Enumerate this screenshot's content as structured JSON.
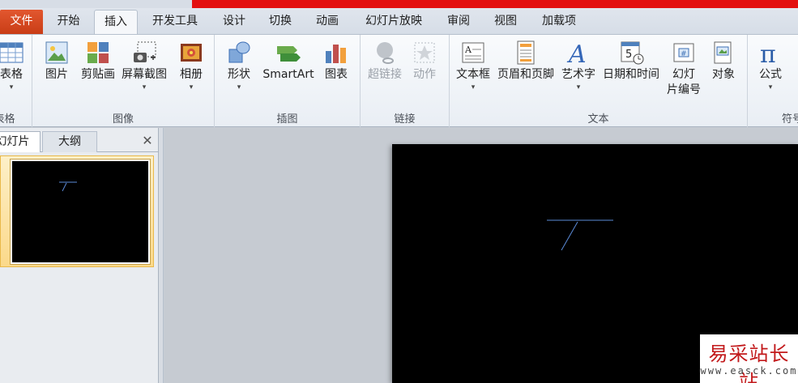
{
  "tabs": {
    "file": "文件",
    "home": "开始",
    "insert": "插入",
    "developer": "开发工具",
    "design": "设计",
    "transitions": "切换",
    "animations": "动画",
    "slideshow": "幻灯片放映",
    "review": "审阅",
    "view": "视图",
    "addins": "加载项"
  },
  "ribbon": {
    "tables": {
      "label": "表格",
      "table": "表格"
    },
    "images": {
      "label": "图像",
      "picture": "图片",
      "clipart": "剪贴画",
      "screenshot": "屏幕截图",
      "album": "相册"
    },
    "illustrations": {
      "label": "插图",
      "shapes": "形状",
      "smartart": "SmartArt",
      "chart": "图表"
    },
    "links": {
      "label": "链接",
      "hyperlink": "超链接",
      "action": "动作"
    },
    "text": {
      "label": "文本",
      "textbox": "文本框",
      "header_footer": "页眉和页脚",
      "wordart": "艺术字",
      "datetime": "日期和时间",
      "slide_number_1": "幻灯",
      "slide_number_2": "片编号",
      "object": "对象"
    },
    "symbols": {
      "label": "符号",
      "equation": "公式"
    },
    "dropdown": "▾"
  },
  "panel": {
    "slides_tab": "幻灯片",
    "outline_tab": "大纲",
    "close": "✕"
  },
  "watermark": {
    "title": "易采站长站",
    "url": "www.easck.com"
  },
  "colors": {
    "file_tab": "#d14a22",
    "title_red": "#e30f0f",
    "stroke_blue": "#5b8bd9",
    "slide_bg": "#000000"
  }
}
